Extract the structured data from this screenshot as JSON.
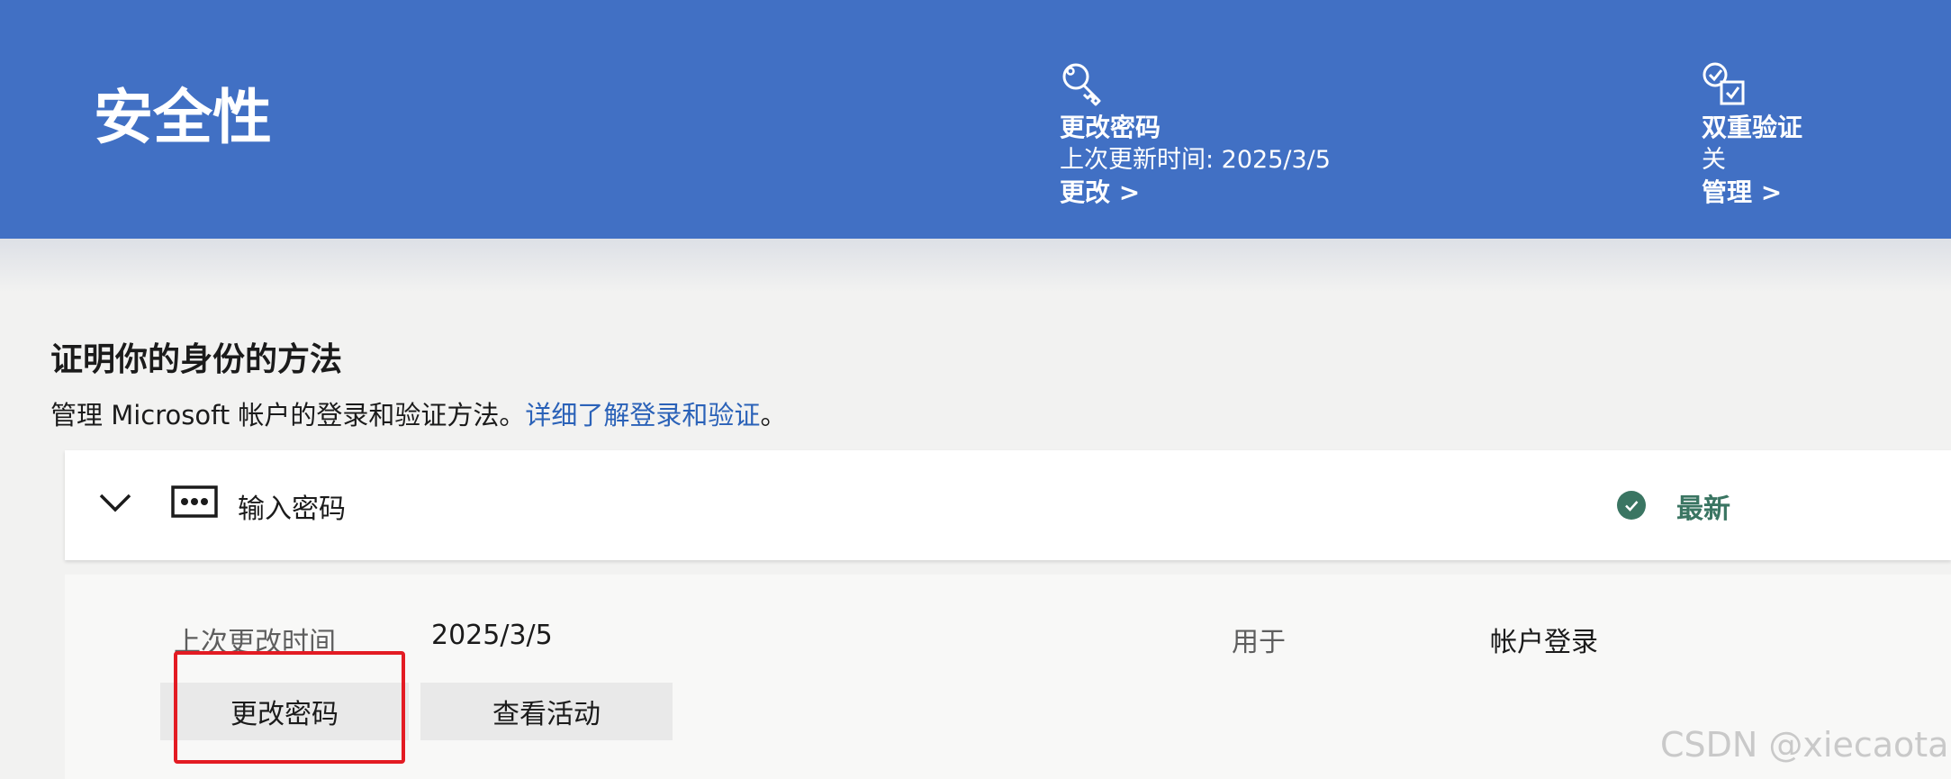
{
  "header": {
    "title": "安全性",
    "password": {
      "icon": "key-icon",
      "title": "更改密码",
      "subtitle": "上次更新时间: 2025/3/5",
      "link": "更改 >"
    },
    "two_step": {
      "icon": "checklist-icon",
      "title": "双重验证",
      "status": "关",
      "link": "管理 >"
    },
    "colors": {
      "background": "#4170c4",
      "text": "#ffffff"
    }
  },
  "section": {
    "title": "证明你的身份的方法",
    "description": "管理 Microsoft 帐户的登录和验证方法。",
    "link": "详细了解登录和验证",
    "description_end": "。",
    "link_color": "#2b62b8"
  },
  "method_card": {
    "chevron_icon": "chevron-down-icon",
    "method_icon": "password-dots-icon",
    "label": "输入密码",
    "status_icon": "check-circle-icon",
    "status": "最新",
    "status_color": "#3a7562"
  },
  "details": {
    "last_changed_label": "上次更改时间",
    "last_changed_value": "2025/3/5",
    "used_for_label": "用于",
    "used_for_value": "帐户登录",
    "change_password_button": "更改密码",
    "view_activity_button": "查看活动",
    "highlight_color": "#e31b23"
  },
  "watermark": "CSDN @xiecaotai"
}
